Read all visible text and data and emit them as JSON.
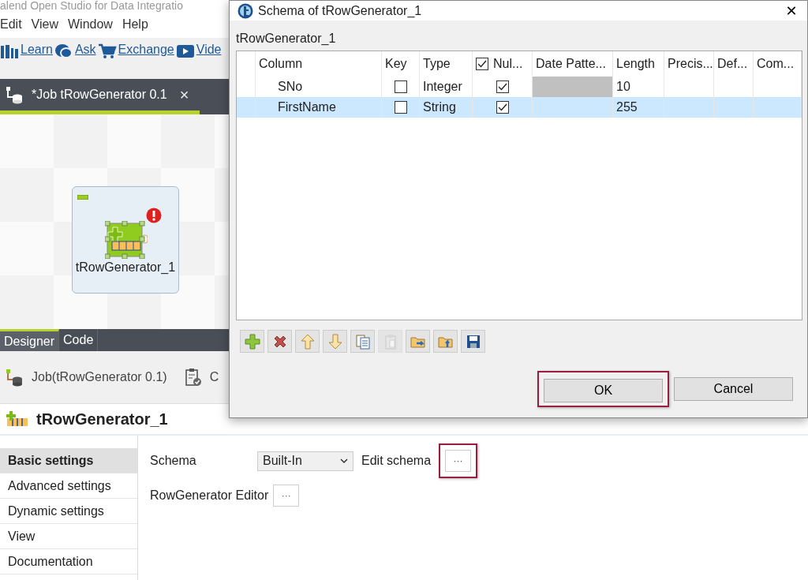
{
  "app": {
    "title": "alend Open Studio for Data Integratio",
    "menu": [
      "Edit",
      "View",
      "Window",
      "Help"
    ],
    "links": [
      {
        "kind": "learn",
        "label": "Learn"
      },
      {
        "kind": "ask",
        "label": "Ask"
      },
      {
        "kind": "exchange",
        "label": "Exchange"
      },
      {
        "kind": "video",
        "label": "Vide"
      }
    ],
    "editor_tab": {
      "label": "*Job tRowGenerator 0.1",
      "close": "×"
    },
    "node": {
      "label": "tRowGenerator_1",
      "error": true
    },
    "view_tabs": [
      {
        "label": "Designer",
        "selected": true
      },
      {
        "label": "Code",
        "selected": false
      }
    ],
    "job_bar": {
      "label": "Job(tRowGenerator 0.1)",
      "next_label": "C"
    },
    "component_title": "tRowGenerator_1",
    "settings_nav": [
      {
        "label": "Basic settings",
        "selected": true
      },
      {
        "label": "Advanced settings",
        "selected": false
      },
      {
        "label": "Dynamic settings",
        "selected": false
      },
      {
        "label": "View",
        "selected": false
      },
      {
        "label": "Documentation",
        "selected": false
      }
    ],
    "settings": {
      "schema_label": "Schema",
      "schema_value": "Built-In",
      "edit_schema_label": "Edit schema",
      "edit_schema_button": "···",
      "edit_schema_highlighted": true,
      "editor_label": "RowGenerator Editor",
      "editor_button": "···",
      "editor_highlighted": false
    }
  },
  "dialog": {
    "title": "Schema of tRowGenerator_1",
    "close": "✕",
    "subtitle": "tRowGenerator_1",
    "columns": [
      {
        "label": "Column",
        "kind": "text"
      },
      {
        "label": "Key",
        "kind": "text"
      },
      {
        "label": "Type",
        "kind": "text"
      },
      {
        "label": "Nul...",
        "kind": "checkbox",
        "checked": true
      },
      {
        "label": "Date Patte...",
        "kind": "text"
      },
      {
        "label": "Length",
        "kind": "text"
      },
      {
        "label": "Precis...",
        "kind": "text"
      },
      {
        "label": "Def...",
        "kind": "text"
      },
      {
        "label": "Com...",
        "kind": "text"
      }
    ],
    "rows": [
      {
        "column": "SNo",
        "key": false,
        "type": "Integer",
        "nullable": true,
        "date_pattern_disabled": true,
        "length": "10",
        "selected": false
      },
      {
        "column": "FirstName",
        "key": false,
        "type": "String",
        "nullable": true,
        "date_pattern_disabled": false,
        "length": "255",
        "selected": true
      }
    ],
    "toolbar": [
      {
        "kind": "add",
        "disabled": false
      },
      {
        "kind": "delete",
        "disabled": false
      },
      {
        "kind": "up",
        "disabled": false
      },
      {
        "kind": "down",
        "disabled": false
      },
      {
        "kind": "copy",
        "disabled": false
      },
      {
        "kind": "paste",
        "disabled": true
      },
      {
        "kind": "import",
        "disabled": false
      },
      {
        "kind": "export",
        "disabled": false
      },
      {
        "kind": "save",
        "disabled": false
      }
    ],
    "buttons": [
      {
        "label": "OK",
        "highlighted": true
      },
      {
        "label": "Cancel",
        "highlighted": false
      }
    ]
  }
}
